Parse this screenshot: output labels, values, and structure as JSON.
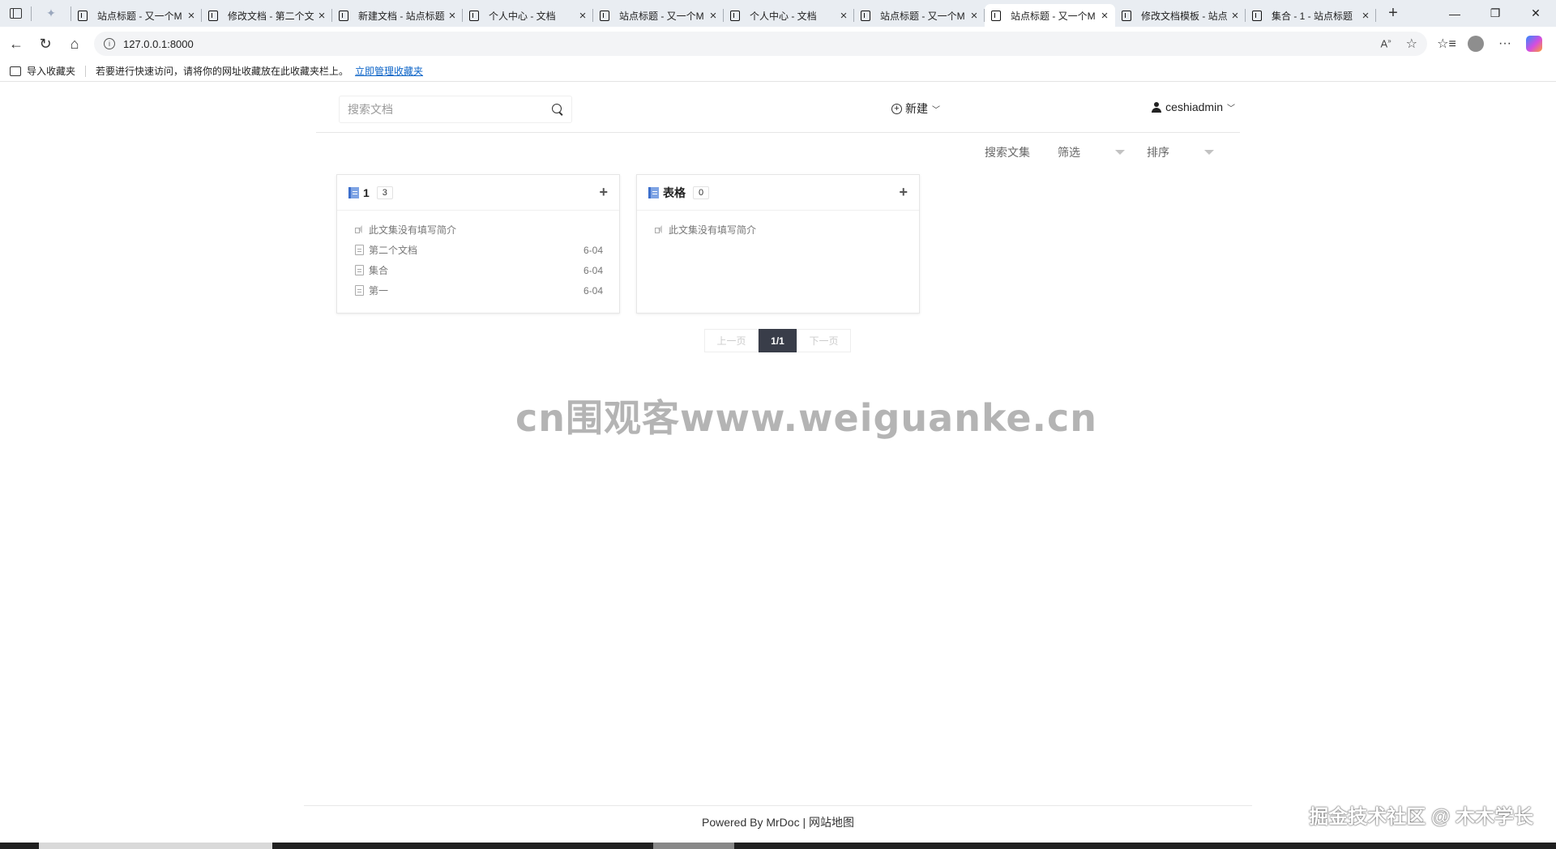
{
  "browser": {
    "tabs": [
      {
        "title": "站点标题 - 又一个M",
        "active": false
      },
      {
        "title": "修改文档 - 第二个文",
        "active": false
      },
      {
        "title": "新建文档 - 站点标题",
        "active": false
      },
      {
        "title": "个人中心 - 文档",
        "active": false
      },
      {
        "title": "站点标题 - 又一个M",
        "active": false
      },
      {
        "title": "个人中心 - 文档",
        "active": false
      },
      {
        "title": "站点标题 - 又一个M",
        "active": false
      },
      {
        "title": "站点标题 - 又一个M",
        "active": true
      },
      {
        "title": "修改文档模板 - 站点",
        "active": false
      },
      {
        "title": "集合 - 1 - 站点标题",
        "active": false
      }
    ],
    "url": "127.0.0.1:8000",
    "favorites": {
      "import_label": "导入收藏夹",
      "hint": "若要进行快速访问，请将你的网址收藏放在此收藏夹栏上。",
      "manage_link": "立即管理收藏夹"
    }
  },
  "header": {
    "search_placeholder": "搜索文档",
    "new_label": "新建",
    "username": "ceshiadmin"
  },
  "filters": {
    "search_label": "搜索文集",
    "filter_label": "筛选",
    "sort_label": "排序"
  },
  "collections": [
    {
      "name": "1",
      "count": "3",
      "intro": "此文集没有填写简介",
      "docs": [
        {
          "title": "第二个文档",
          "date": "6-04"
        },
        {
          "title": "集合",
          "date": "6-04"
        },
        {
          "title": "第一",
          "date": "6-04"
        }
      ]
    },
    {
      "name": "表格",
      "count": "0",
      "intro": "此文集没有填写简介",
      "docs": []
    }
  ],
  "pagination": {
    "prev": "上一页",
    "current": "1/1",
    "next": "下一页"
  },
  "watermark": "cn围观客www.weiguanke.cn",
  "footer": {
    "powered": "Powered By MrDoc |",
    "sitemap": "网站地图"
  },
  "credit": "掘金技术社区 @ 木木学长",
  "colors": {
    "accent_dark": "#393d49",
    "link": "#0b63c7",
    "book_icon": "#7ea3e4"
  }
}
